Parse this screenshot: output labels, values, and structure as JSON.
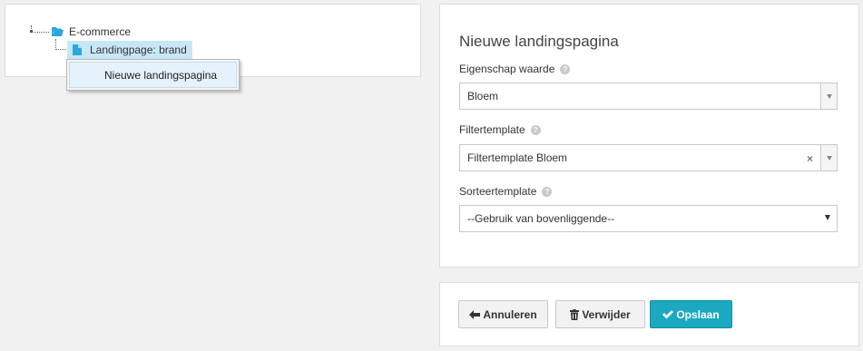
{
  "tree": {
    "root_label": "E-commerce",
    "child_label": "Landingpage: brand",
    "context_menu_item": "Nieuwe landingspagina"
  },
  "form": {
    "title": "Nieuwe landingspagina",
    "field1": {
      "label": "Eigenschap waarde",
      "value": "Bloem"
    },
    "field2": {
      "label": "Filtertemplate",
      "value": "Filtertemplate Bloem",
      "clear": "×"
    },
    "field3": {
      "label": "Sorteertemplate",
      "value": "--Gebruik van bovenliggende--"
    },
    "help_glyph": "?"
  },
  "buttons": {
    "cancel": "Annuleren",
    "delete": "Verwijder",
    "save": "Opslaan"
  },
  "colors": {
    "primary": "#1aa9c1",
    "tree_icon": "#29a9d8",
    "selection": "#c7e7f7"
  }
}
